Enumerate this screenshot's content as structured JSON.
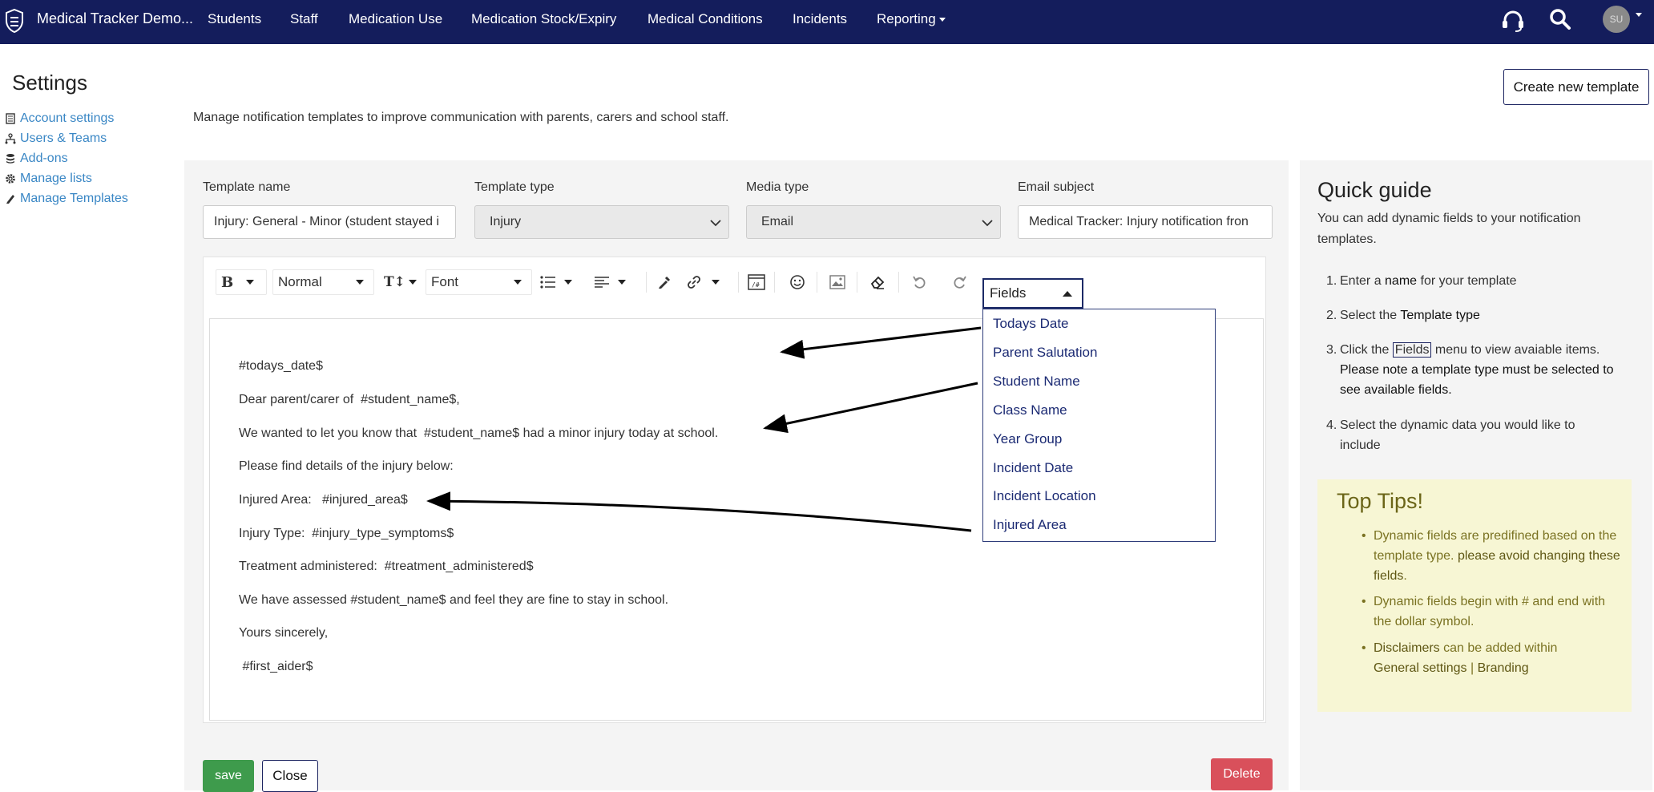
{
  "nav": {
    "brand": "Medical Tracker Demo...",
    "items": [
      "Students",
      "Staff",
      "Medication Use",
      "Medication Stock/Expiry",
      "Medical Conditions",
      "Incidents",
      "Reporting"
    ],
    "avatar": "SU"
  },
  "settings": {
    "title": "Settings",
    "menu": [
      "Account settings",
      "Users & Teams",
      "Add-ons",
      "Manage lists",
      "Manage Templates"
    ]
  },
  "description": "Manage notification templates to improve communication with parents, carers and school staff.",
  "create_button": "Create new template",
  "form": {
    "template_name_label": "Template name",
    "template_name_value": "Injury: General - Minor (student stayed i",
    "template_type_label": "Template type",
    "template_type_value": "Injury",
    "media_type_label": "Media type",
    "media_type_value": "Email",
    "email_subject_label": "Email subject",
    "email_subject_value": "Medical Tracker: Injury notification fron"
  },
  "toolbar": {
    "bold": "B",
    "size": "Normal",
    "font": "Font",
    "fields": "Fields"
  },
  "fields_menu": [
    "Todays Date",
    "Parent Salutation",
    "Student Name",
    "Class Name",
    "Year Group",
    "Incident Date",
    "Incident Location",
    "Injured Area"
  ],
  "editor_lines": [
    "#todays_date$",
    "Dear parent/carer of  #student_name$,",
    "We wanted to let you know that  #student_name$ had a minor injury today at school.",
    "Please find details of the injury below:",
    "Injured Area:   #injured_area$",
    "Injury Type:  #injury_type_symptoms$",
    "Treatment administered:  #treatment_administered$",
    "We have assessed #student_name$ and feel they are fine to stay in school.",
    "Yours sincerely,",
    " #first_aider$"
  ],
  "buttons": {
    "save": "save",
    "close": "Close",
    "delete": "Delete"
  },
  "guide": {
    "title": "Quick guide",
    "intro": "You can add dynamic fields to your notification templates.",
    "step1_a": "Enter a ",
    "step1_b": "name",
    "step1_c": " for your template",
    "step2_a": "Select the ",
    "step2_b": "Template type",
    "step3_a": "Click the ",
    "step3_b": "Fields",
    "step3_c": " menu to view avaiable items.",
    "step3_d": "Please note a template type must be selected to see available fields.",
    "step4": "Select the dynamic data you would like to include",
    "tips_title": "Top Tips!",
    "tip1_a": "Dynamic fields are predifined based on the template type. ",
    "tip1_b": "please avoid changing these fields",
    "tip2": "Dynamic fields begin with # and end with the dollar symbol.",
    "tip3_a": "Disclaimers",
    "tip3_b": " can be added within ",
    "tip3_c": "General settings",
    "tip3_d": " | ",
    "tip3_e": "Branding"
  }
}
